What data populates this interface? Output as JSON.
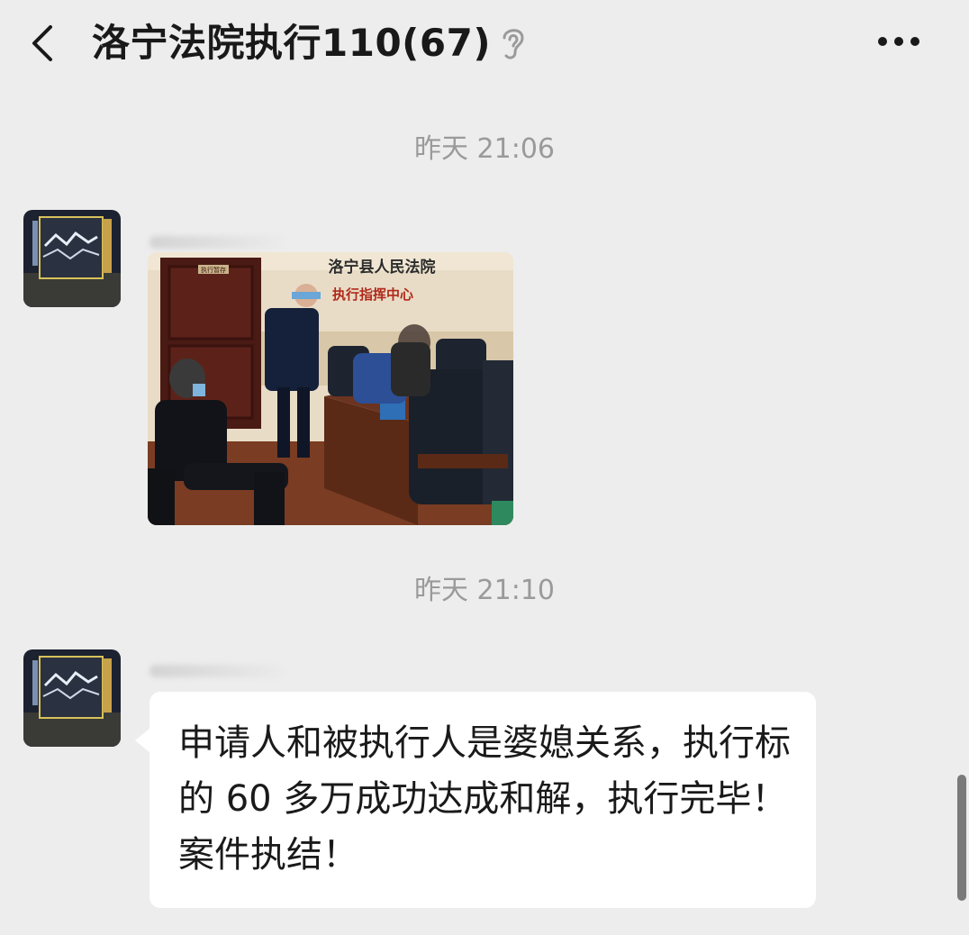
{
  "header": {
    "title": "洛宁法院执行110(67)",
    "back_icon": "chevron-left-icon",
    "mute_icon": "ear-icon",
    "more_icon": "ellipsis-icon"
  },
  "messages": [
    {
      "timestamp": "昨天 21:06",
      "type": "image",
      "image_text": {
        "court_sign_line1": "洛宁县人民法院",
        "court_sign_line2": "执行指挥中心",
        "door_plate": "执行暂存"
      }
    },
    {
      "timestamp": "昨天 21:10",
      "type": "text",
      "text": "申请人和被执行人是婆媳关系，执行标的 60 多万成功达成和解，执行完毕！案件执结！"
    }
  ],
  "colors": {
    "background": "#ededed",
    "bubble": "#ffffff",
    "timestamp": "#9a9a9a"
  }
}
